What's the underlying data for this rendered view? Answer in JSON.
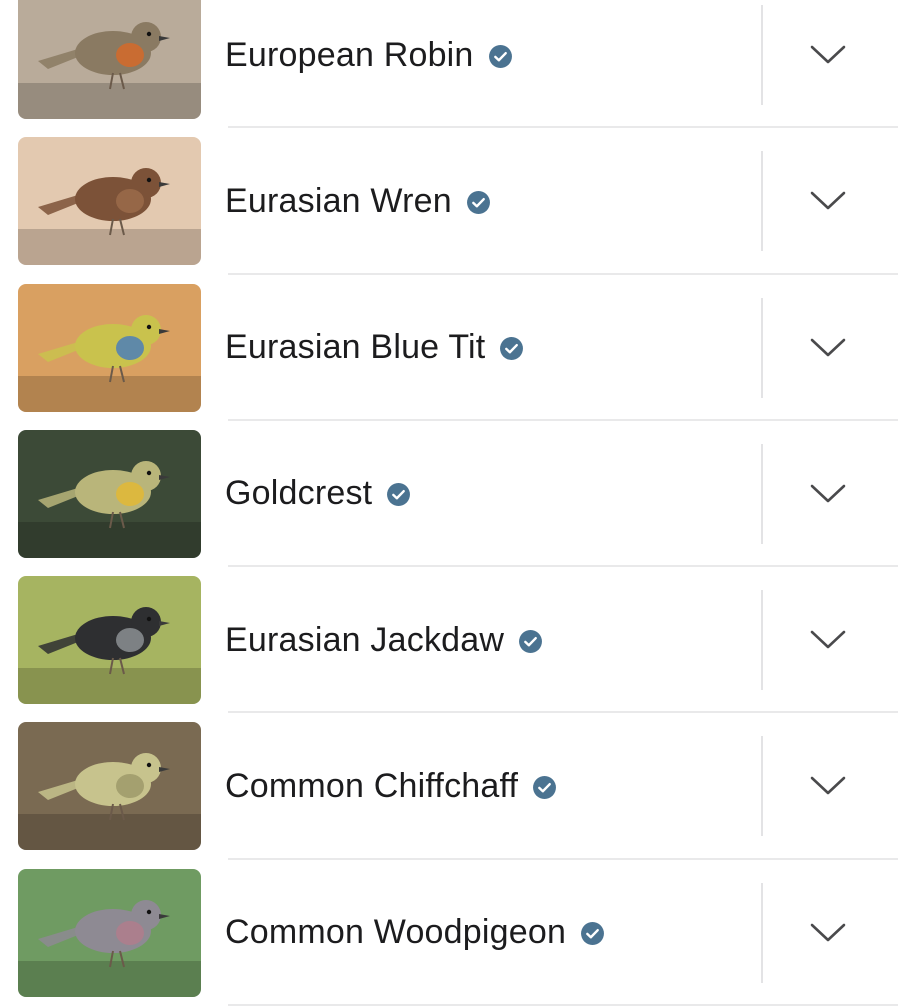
{
  "species": [
    {
      "name": "European Robin",
      "verified_icon": "verified-check-icon",
      "expand_icon": "chevron-down-icon",
      "bg": "#b9ab9a",
      "body": "#8a7a62",
      "accent": "#d36a2a"
    },
    {
      "name": "Eurasian Wren",
      "verified_icon": "verified-check-icon",
      "expand_icon": "chevron-down-icon",
      "bg": "#e3c9b0",
      "body": "#7c5238",
      "accent": "#9b6b4a"
    },
    {
      "name": "Eurasian Blue Tit",
      "verified_icon": "verified-check-icon",
      "expand_icon": "chevron-down-icon",
      "bg": "#d9a061",
      "body": "#c9c24d",
      "accent": "#4c7fb8"
    },
    {
      "name": "Goldcrest",
      "verified_icon": "verified-check-icon",
      "expand_icon": "chevron-down-icon",
      "bg": "#3c4a37",
      "body": "#b9b57a",
      "accent": "#e2b935"
    },
    {
      "name": "Eurasian Jackdaw",
      "verified_icon": "verified-check-icon",
      "expand_icon": "chevron-down-icon",
      "bg": "#a6b461",
      "body": "#2e2f31",
      "accent": "#8b8f93"
    },
    {
      "name": "Common Chiffchaff",
      "verified_icon": "verified-check-icon",
      "expand_icon": "chevron-down-icon",
      "bg": "#7a6a52",
      "body": "#c7c38d",
      "accent": "#9d9a6a"
    },
    {
      "name": "Common Woodpigeon",
      "verified_icon": "verified-check-icon",
      "expand_icon": "chevron-down-icon",
      "bg": "#6f9b62",
      "body": "#8e8a93",
      "accent": "#b07c8c"
    }
  ],
  "colors": {
    "verified": "#4b7391",
    "chevron": "#4a4a4c",
    "text": "#1c1c1e"
  }
}
